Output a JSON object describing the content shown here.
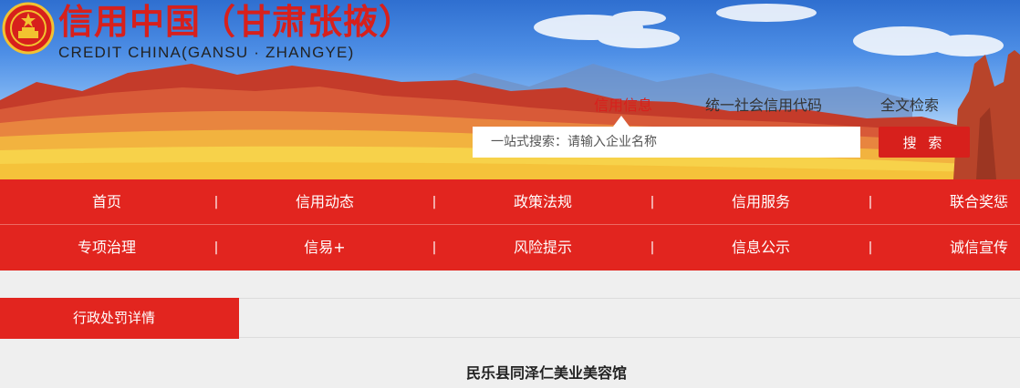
{
  "header": {
    "title": "信用中国（甘肃张掖）",
    "subtitle": "CREDIT CHINA(GANSU · ZHANGYE)"
  },
  "search": {
    "tabs": [
      {
        "label": "信用信息",
        "active": true
      },
      {
        "label": "统一社会信用代码",
        "active": false
      },
      {
        "label": "全文检索",
        "active": false
      }
    ],
    "placeholder": "一站式搜索：请输入企业名称",
    "button_label": "搜 索"
  },
  "nav": {
    "row1": [
      "首页",
      "信用动态",
      "政策法规",
      "信用服务",
      "联合奖惩"
    ],
    "row2": [
      "专项治理",
      "信易+",
      "风险提示",
      "信息公示",
      "诚信宣传"
    ],
    "separator": "|"
  },
  "section": {
    "tab_label": "行政处罚详情"
  },
  "detail": {
    "entity_name": "民乐县同泽仁美业美容馆"
  },
  "colors": {
    "brand_red": "#e2251f",
    "title_red": "#d7201c",
    "background": "#efefef"
  }
}
